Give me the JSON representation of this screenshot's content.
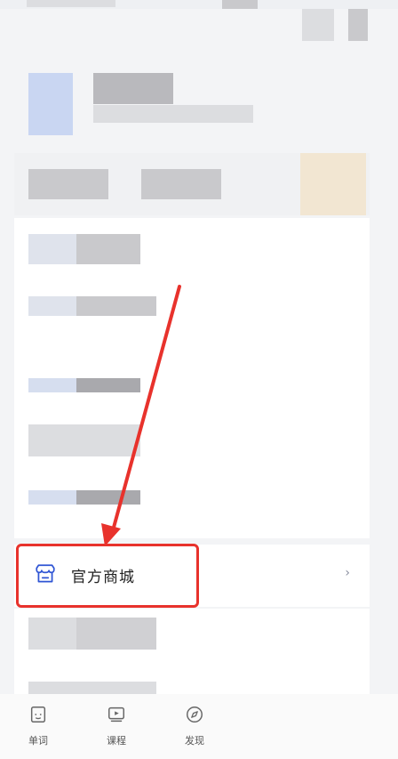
{
  "menu": {
    "mall_label": "官方商城",
    "mall_icon": "store-icon",
    "chevron": "›"
  },
  "tabbar": {
    "items": [
      {
        "label": "单词",
        "icon": "vocabulary-icon"
      },
      {
        "label": "课程",
        "icon": "video-course-icon"
      },
      {
        "label": "发现",
        "icon": "compass-icon"
      }
    ]
  },
  "annotation": {
    "color": "#e8322c"
  }
}
